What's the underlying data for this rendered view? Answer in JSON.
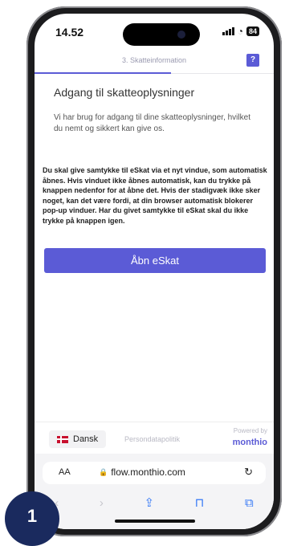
{
  "status_bar": {
    "time": "14.52",
    "battery": "84"
  },
  "step": {
    "title": "3. Skatteinformation",
    "help_label": "?"
  },
  "content": {
    "heading": "Adgang til skatteoplysninger",
    "intro": "Vi har brug for adgang til dine skatteoplysninger, hvilket du nemt og sikkert kan give os.",
    "instructions": "Du skal give samtykke til eSkat via et nyt vindue, som automatisk åbnes. Hvis vinduet ikke åbnes automatisk, kan du trykke på knappen nedenfor for at åbne det. Hvis der stadigvæk ikke sker noget, kan det være fordi, at din browser automatisk blokerer pop-up vinduer. Har du givet samtykke til eSkat skal du ikke trykke på knappen igen.",
    "button_label": "Åbn eSkat"
  },
  "footer": {
    "language": "Dansk",
    "privacy_link": "Persondatapolitik",
    "powered_by": "Powered by",
    "brand": "monthio"
  },
  "browser": {
    "aa_label": "AA",
    "url": "flow.monthio.com",
    "toolbar_icons": [
      "back-icon",
      "forward-icon",
      "share-icon",
      "bookmarks-icon",
      "tabs-icon"
    ]
  },
  "badge": {
    "number": "1"
  },
  "colors": {
    "accent": "#5b5bd6",
    "badge": "#1a2a5e",
    "flag_red": "#c8102e"
  }
}
